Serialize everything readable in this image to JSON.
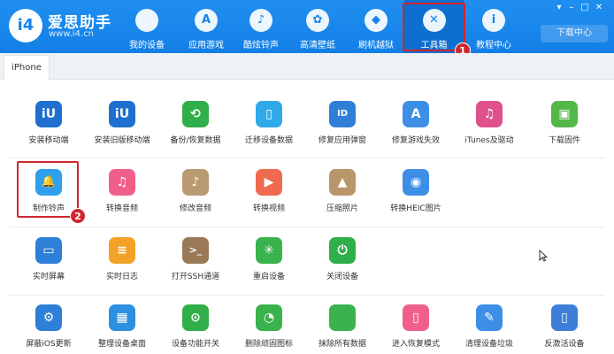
{
  "app": {
    "title": "爱思助手",
    "url": "www.i4.cn",
    "logo_mark": "i4"
  },
  "nav": [
    {
      "label": "我的设备",
      "icon": "apple-icon",
      "glyph": ""
    },
    {
      "label": "应用游戏",
      "icon": "app-store-icon",
      "glyph": "A"
    },
    {
      "label": "酷炫铃声",
      "icon": "bell-icon",
      "glyph": "♪"
    },
    {
      "label": "高清壁纸",
      "icon": "flower-icon",
      "glyph": "✿"
    },
    {
      "label": "刷机越狱",
      "icon": "dropbox-icon",
      "glyph": "◆"
    },
    {
      "label": "工具箱",
      "icon": "tools-icon",
      "glyph": "✕"
    },
    {
      "label": "教程中心",
      "icon": "info-icon",
      "glyph": "i"
    }
  ],
  "window": {
    "download_center": "下载中心",
    "minimize": "–",
    "maximize": "□",
    "close": "✕",
    "settings": "▾"
  },
  "tab": {
    "label": "iPhone"
  },
  "tools": [
    [
      {
        "label": "安装移动端",
        "color": "#1e6fd0",
        "glyph": "iU"
      },
      {
        "label": "安装旧版移动端",
        "color": "#1e6fd0",
        "glyph": "iU"
      },
      {
        "label": "备份/恢复数据",
        "color": "#2fae4a",
        "glyph": "⟲"
      },
      {
        "label": "迁移设备数据",
        "color": "#2fa9e8",
        "glyph": "▯"
      },
      {
        "label": "修复应用弹窗",
        "color": "#2f7fd6",
        "glyph": "ID"
      },
      {
        "label": "修复游戏失效",
        "color": "#3d8fe6",
        "glyph": "A"
      },
      {
        "label": "iTunes及驱动",
        "color": "#e0508a",
        "glyph": "♫"
      },
      {
        "label": "下载固件",
        "color": "#52b848",
        "glyph": "▣"
      }
    ],
    [
      {
        "label": "制作铃声",
        "color": "#2ea0ee",
        "glyph": "🔔"
      },
      {
        "label": "转换音频",
        "color": "#ef5f8a",
        "glyph": "♫"
      },
      {
        "label": "修改音频",
        "color": "#b99a72",
        "glyph": "♪"
      },
      {
        "label": "转换视频",
        "color": "#f06a4f",
        "glyph": "▶"
      },
      {
        "label": "压缩照片",
        "color": "#b9956a",
        "glyph": "▲"
      },
      {
        "label": "转换HEIC图片",
        "color": "#3d8fe6",
        "glyph": "◉"
      }
    ],
    [
      {
        "label": "实时屏幕",
        "color": "#2d7fd8",
        "glyph": "▭"
      },
      {
        "label": "实时日志",
        "color": "#f2a228",
        "glyph": "≡"
      },
      {
        "label": "打开SSH通道",
        "color": "#9a7a56",
        "glyph": ">_"
      },
      {
        "label": "重启设备",
        "color": "#3ab34f",
        "glyph": "✳"
      },
      {
        "label": "关闭设备",
        "color": "#2fae4a",
        "glyph": "⏻"
      }
    ],
    [
      {
        "label": "屏蔽iOS更新",
        "color": "#2d7fd8",
        "glyph": "⚙"
      },
      {
        "label": "整理设备桌面",
        "color": "#2d8fe0",
        "glyph": "▦"
      },
      {
        "label": "设备功能开关",
        "color": "#2fae4a",
        "glyph": "⊙"
      },
      {
        "label": "删除顽固图标",
        "color": "#3ab34f",
        "glyph": "◔"
      },
      {
        "label": "抹除所有数据",
        "color": "#3ab34f",
        "glyph": ""
      },
      {
        "label": "进入恢复模式",
        "color": "#ef5f8a",
        "glyph": "▯"
      },
      {
        "label": "清理设备垃圾",
        "color": "#3d8fe6",
        "glyph": "✎"
      },
      {
        "label": "反激活设备",
        "color": "#3d7fd8",
        "glyph": "▯"
      }
    ]
  ],
  "callouts": {
    "step1": "1",
    "step2": "2"
  }
}
